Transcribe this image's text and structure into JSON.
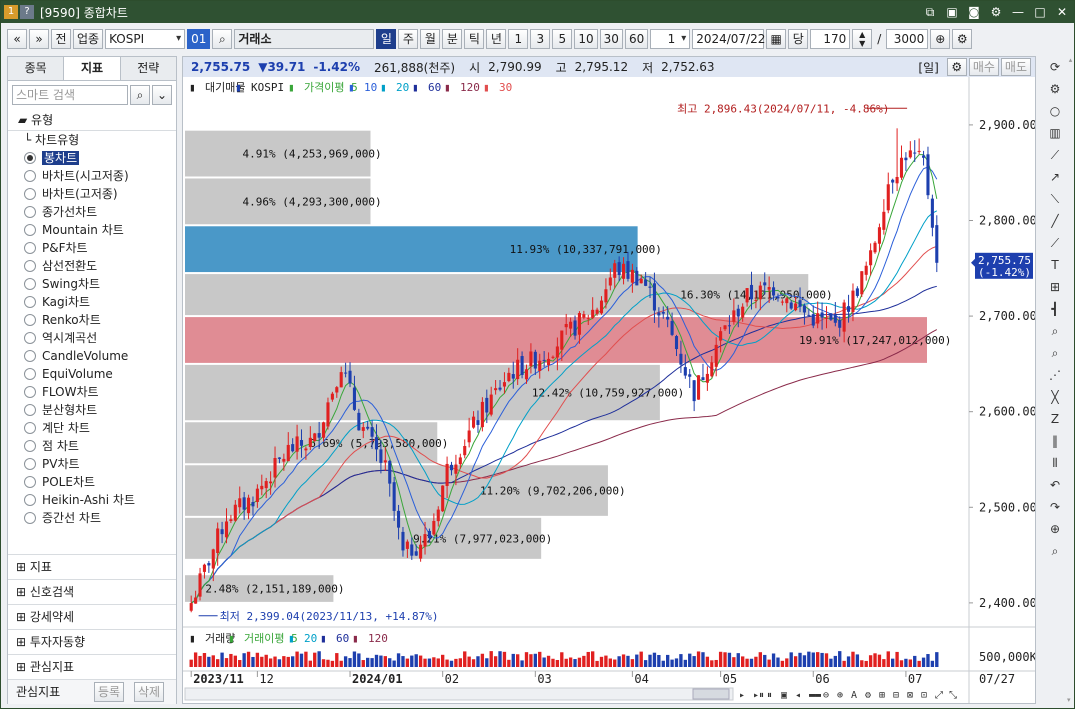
{
  "window": {
    "title": "[9590] 종합차트",
    "title_icon_1": "1",
    "title_icon_2": "?"
  },
  "toolbar": {
    "nav_prev": "«",
    "nav_down": "»",
    "btn_jeon": "전",
    "btn_upjong": "업종",
    "symbol_value": "KOSPI",
    "symbol_code": "01",
    "market_name": "거래소",
    "periods": [
      "일",
      "주",
      "월",
      "분",
      "틱",
      "년"
    ],
    "selected_period": "일",
    "intervals": [
      "1",
      "3",
      "5",
      "10",
      "30",
      "60"
    ],
    "interval_dd_value": "1",
    "date_value": "2024/07/22",
    "btn_dang": "당",
    "count_value": "170",
    "slash": "/",
    "total_value": "3000"
  },
  "left_panel": {
    "tabs": [
      "종목",
      "지표",
      "전략"
    ],
    "selected_tab": "지표",
    "search_placeholder": "스마트 검색",
    "section_type": "유형",
    "tree_root": "차트유형",
    "items": [
      "봉차트",
      "바차트(시고저종)",
      "바차트(고저종)",
      "종가선차트",
      "Mountain 차트",
      "P&F차트",
      "삼선전환도",
      "Swing차트",
      "Kagi차트",
      "Renko차트",
      "역시계곡선",
      "CandleVolume",
      "EquiVolume",
      "FLOW차트",
      "분산형차트",
      "계단 차트",
      "점 차트",
      "PV차트",
      "POLE차트",
      "Heikin-Ashi 차트",
      "증간선 차트"
    ],
    "selected_item": "봉차트",
    "footer_sections": [
      "지표",
      "신호검색",
      "강세약세",
      "투자자동향",
      "관심지표"
    ],
    "bottom_label": "관심지표",
    "btn_register": "등록",
    "btn_delete": "삭제"
  },
  "infobar": {
    "price": "2,755.75",
    "change": "▼39.71",
    "change_pct": "-1.42%",
    "volume": "261,888(천주)",
    "open_label": "시",
    "open_value": "2,790.99",
    "high_label": "고",
    "high_value": "2,795.12",
    "low_label": "저",
    "low_value": "2,752.63",
    "period_tag": "[일]",
    "btn_buy": "매수",
    "btn_sell": "매도"
  },
  "legend": {
    "vp": "대기매물",
    "kospi": "KOSPI",
    "ma_label": "가격이평 5",
    "ma_10": "10",
    "ma_20": "20",
    "ma_60": "60",
    "ma_120": "120",
    "ma_30": "30"
  },
  "volume_legend": {
    "volume": "거래량",
    "vma_label": "거래이평 5",
    "vma_20": "20",
    "vma_60": "60",
    "vma_120": "120"
  },
  "annotations": {
    "high": "최고 2,896.43(2024/07/11, -4.86%)",
    "low": "최저 2,399.04(2023/11/13, +14.87%)",
    "price_tag": "2,755.75",
    "price_tag_pct": "(-1.42%)",
    "vol_axis_label": "500,000K",
    "last_date": "07/27"
  },
  "colors": {
    "up": "#e02020",
    "down": "#1d3fae",
    "ma5": "#3aa63a",
    "ma10": "#2b5fd9",
    "ma20": "#00a0c8",
    "ma60": "#1f2f9a",
    "ma120": "#8a2a4a",
    "ma30": "#e14e4e",
    "vp_gray": "#c8c8c8",
    "vp_blue": "#4a98c8",
    "vp_red": "#e08c94"
  },
  "chart_data": {
    "type": "candlestick",
    "symbol": "KOSPI",
    "y_range": [
      2380,
      2925
    ],
    "y_ticks": [
      2400,
      2500,
      2600,
      2700,
      2800,
      2900
    ],
    "y_tick_labels": [
      "2,400.00",
      "2,500.00",
      "2,600.00",
      "2,700.00",
      "2,800.00",
      "2,900.00"
    ],
    "x_labels": [
      "2023/11",
      "12",
      "2024/01",
      "02",
      "03",
      "04",
      "05",
      "06",
      "07"
    ],
    "x_label_bars": [
      0,
      15,
      36,
      57,
      78,
      100,
      120,
      141,
      162
    ],
    "bar_count": 170,
    "last_close": 2755.75,
    "high": {
      "value": 2896.43,
      "date": "2024/07/11",
      "bar": 160
    },
    "low": {
      "value": 2399.04,
      "date": "2023/11/13",
      "bar": 1
    },
    "close_keypoints": [
      [
        0,
        2400
      ],
      [
        8,
        2490
      ],
      [
        14,
        2510
      ],
      [
        22,
        2560
      ],
      [
        28,
        2570
      ],
      [
        34,
        2650
      ],
      [
        38,
        2590
      ],
      [
        44,
        2540
      ],
      [
        48,
        2450
      ],
      [
        54,
        2470
      ],
      [
        58,
        2540
      ],
      [
        66,
        2600
      ],
      [
        72,
        2640
      ],
      [
        80,
        2660
      ],
      [
        92,
        2710
      ],
      [
        96,
        2750
      ],
      [
        102,
        2740
      ],
      [
        108,
        2690
      ],
      [
        114,
        2620
      ],
      [
        120,
        2680
      ],
      [
        126,
        2720
      ],
      [
        132,
        2730
      ],
      [
        140,
        2700
      ],
      [
        146,
        2690
      ],
      [
        150,
        2720
      ],
      [
        154,
        2760
      ],
      [
        158,
        2840
      ],
      [
        162,
        2870
      ],
      [
        166,
        2860
      ],
      [
        168,
        2800
      ],
      [
        169,
        2756
      ]
    ],
    "volume_profile": [
      {
        "low": 2400,
        "high": 2430,
        "pct": "2.48%",
        "amount": "2,151,189,000",
        "width_ratio": 0.2
      },
      {
        "low": 2445,
        "high": 2490,
        "pct": "9.21%",
        "amount": "7,977,023,000",
        "width_ratio": 0.48
      },
      {
        "low": 2490,
        "high": 2545,
        "pct": "11.20%",
        "amount": "9,702,206,000",
        "width_ratio": 0.57
      },
      {
        "low": 2545,
        "high": 2590,
        "pct": "6.69%",
        "amount": "5,793,580,000",
        "width_ratio": 0.34
      },
      {
        "low": 2590,
        "high": 2650,
        "pct": "12.42%",
        "amount": "10,759,927,000",
        "width_ratio": 0.64
      },
      {
        "low": 2650,
        "high": 2700,
        "pct": "19.91%",
        "amount": "17,247,012,000",
        "width_ratio": 1.0
      },
      {
        "low": 2700,
        "high": 2745,
        "pct": "16.30%",
        "amount": "14,121,950,000",
        "width_ratio": 0.84
      },
      {
        "low": 2745,
        "high": 2795,
        "pct": "11.93%",
        "amount": "10,337,791,000",
        "width_ratio": 0.61
      },
      {
        "low": 2795,
        "high": 2845,
        "pct": "4.96%",
        "amount": "4,293,300,000",
        "width_ratio": 0.25
      },
      {
        "low": 2845,
        "high": 2895,
        "pct": "4.91%",
        "amount": "4,253,969,000",
        "width_ratio": 0.25
      }
    ],
    "volume_axis": {
      "label": "500,000K",
      "value": 500000
    }
  }
}
